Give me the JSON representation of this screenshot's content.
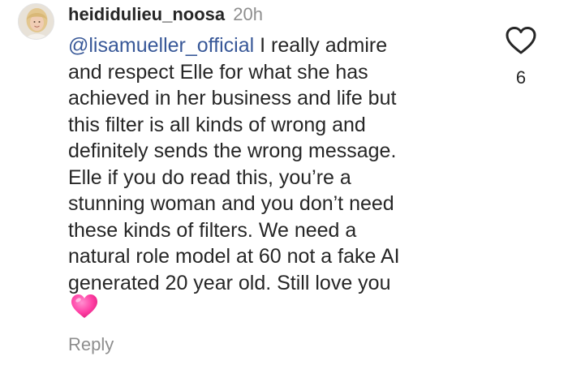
{
  "comment": {
    "username": "heididulieu_noosa",
    "timestamp": "20h",
    "mention": "@lisamueller_official",
    "lines": [
      " I really admire",
      "and respect Elle for what she has",
      "achieved in her business and life but",
      "this filter is all kinds of wrong and",
      "definitely sends the wrong message.",
      "Elle if you do read this, you’re a",
      "stunning woman and you don’t need",
      "these kinds of filters. We need a",
      "natural role model at 60 not a fake AI",
      "generated 20 year old.  Still love you"
    ],
    "emoji": "pink-heart-emoji",
    "reply_label": "Reply",
    "like_count": "6"
  },
  "colors": {
    "text": "#262626",
    "mention": "#385898",
    "secondary": "#8e8e8e",
    "heart_emoji": "#ff3fa4"
  }
}
